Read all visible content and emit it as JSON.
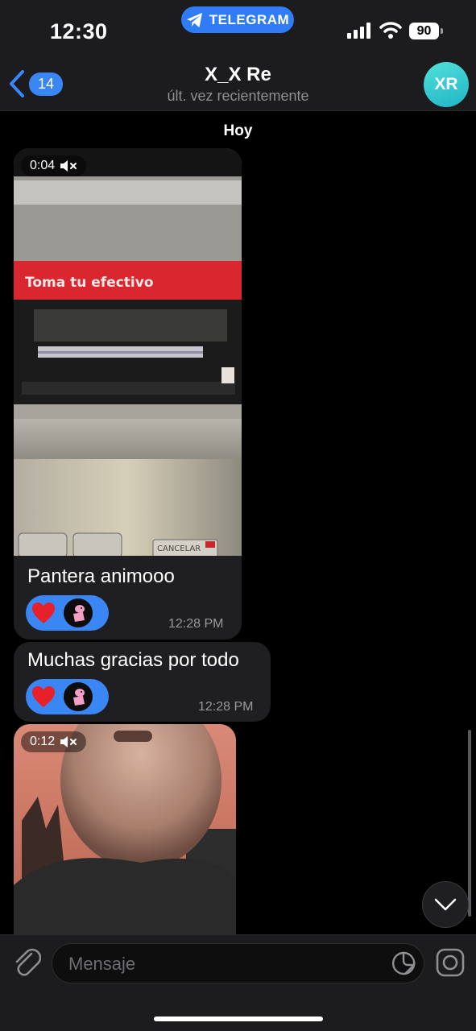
{
  "status_bar": {
    "time": "12:30",
    "pill_label": "TELEGRAM",
    "battery": "90"
  },
  "header": {
    "back_count": "14",
    "title": "X_X Re",
    "subtitle": "últ. vez recientemente",
    "avatar_initials": "XR"
  },
  "chat": {
    "date_chip": "Hoy",
    "messages": [
      {
        "type": "video",
        "duration": "0:04",
        "video_text": "Toma tu efectivo",
        "button_text": "CANCELAR",
        "caption": "Pantera animooo",
        "time": "12:28 PM",
        "reactions": [
          "heart-icon",
          "pink-panther-avatar"
        ]
      },
      {
        "type": "text",
        "text": "Muchas gracias por todo",
        "time": "12:28 PM",
        "reactions": [
          "heart-icon",
          "pink-panther-avatar"
        ]
      },
      {
        "type": "video",
        "duration": "0:12"
      }
    ]
  },
  "input": {
    "placeholder": "Mensaje"
  },
  "colors": {
    "accent": "#3a86f5",
    "bubble": "#1f1f21",
    "bar": "#1c1c1e",
    "avatar": "#2cc3cf",
    "heart": "#e8202a"
  }
}
